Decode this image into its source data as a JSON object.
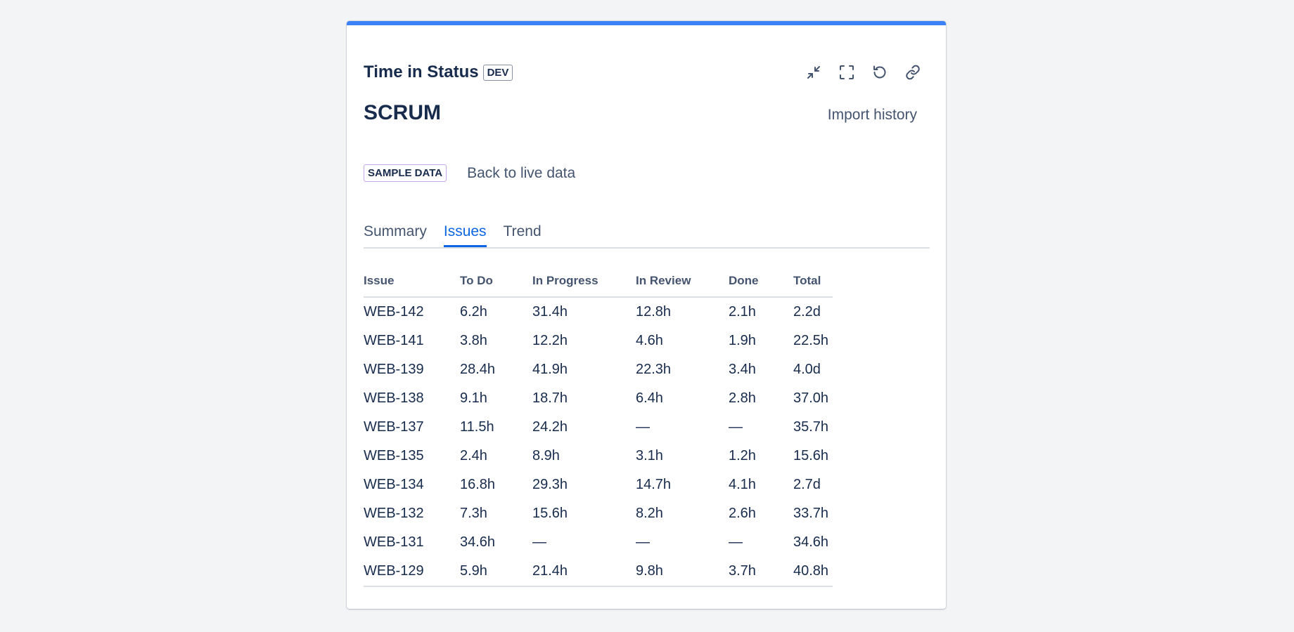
{
  "header": {
    "title": "Time in Status",
    "badge": "DEV",
    "accent_color": "#3b82f6",
    "actions": [
      {
        "name": "collapse-button",
        "icon": "collapse-icon"
      },
      {
        "name": "fullscreen-button",
        "icon": "fullscreen-icon"
      },
      {
        "name": "refresh-button",
        "icon": "refresh-icon"
      },
      {
        "name": "copy-link-button",
        "icon": "link-icon"
      }
    ]
  },
  "project": {
    "title": "SCRUM",
    "import_label": "Import history"
  },
  "sample": {
    "badge": "SAMPLE DATA",
    "back_label": "Back to live data"
  },
  "tabs": [
    {
      "label": "Summary",
      "active": false
    },
    {
      "label": "Issues",
      "active": true
    },
    {
      "label": "Trend",
      "active": false
    }
  ],
  "table": {
    "columns": [
      "Issue",
      "To Do",
      "In Progress",
      "In Review",
      "Done",
      "Total"
    ],
    "rows": [
      [
        "WEB-142",
        "6.2h",
        "31.4h",
        "12.8h",
        "2.1h",
        "2.2d"
      ],
      [
        "WEB-141",
        "3.8h",
        "12.2h",
        "4.6h",
        "1.9h",
        "22.5h"
      ],
      [
        "WEB-139",
        "28.4h",
        "41.9h",
        "22.3h",
        "3.4h",
        "4.0d"
      ],
      [
        "WEB-138",
        "9.1h",
        "18.7h",
        "6.4h",
        "2.8h",
        "37.0h"
      ],
      [
        "WEB-137",
        "11.5h",
        "24.2h",
        "—",
        "—",
        "35.7h"
      ],
      [
        "WEB-135",
        "2.4h",
        "8.9h",
        "3.1h",
        "1.2h",
        "15.6h"
      ],
      [
        "WEB-134",
        "16.8h",
        "29.3h",
        "14.7h",
        "4.1h",
        "2.7d"
      ],
      [
        "WEB-132",
        "7.3h",
        "15.6h",
        "8.2h",
        "2.6h",
        "33.7h"
      ],
      [
        "WEB-131",
        "34.6h",
        "—",
        "—",
        "—",
        "34.6h"
      ],
      [
        "WEB-129",
        "5.9h",
        "21.4h",
        "9.8h",
        "3.7h",
        "40.8h"
      ]
    ]
  }
}
